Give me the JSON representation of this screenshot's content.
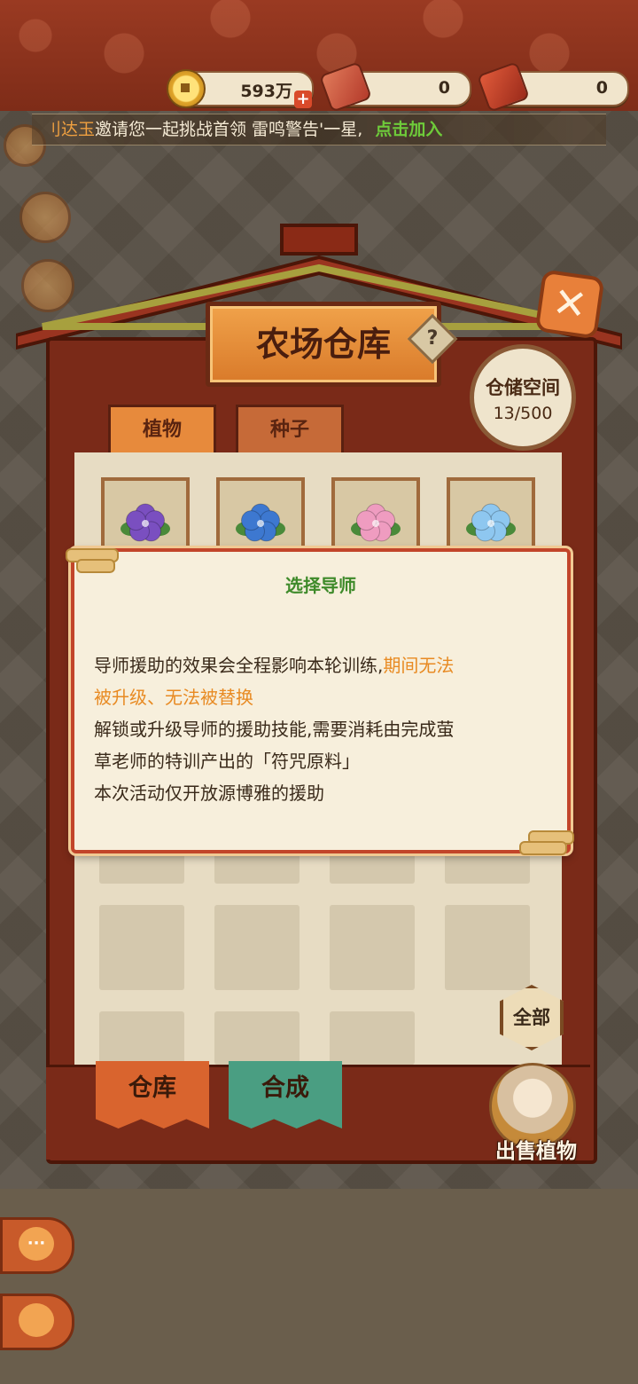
{
  "currency": {
    "coins": "593万",
    "coins_plus": "+",
    "ticket_a": "0",
    "ticket_b": "0"
  },
  "notice": {
    "name": "刂达玉",
    "message": "邀请您一起挑战首领 雷鸣警告'一星,",
    "join": "点击加入"
  },
  "warehouse": {
    "title": "农场仓库",
    "help": "?",
    "close": "✕",
    "storage_label": "仓储空间",
    "storage_value": "13/500",
    "tabs": [
      "植物",
      "种子"
    ],
    "all_button": "全部",
    "bottom_tabs": [
      "仓库",
      "合成"
    ],
    "sell_label": "出售植物",
    "flower_colors": [
      "#7a4fc0",
      "#3d78d0",
      "#ef9cc0",
      "#8ec7f0"
    ]
  },
  "dialog": {
    "title": "选择导师",
    "line1_normal": "导师援助的效果会全程影响本轮训练,",
    "line1_highlight": "期间无法",
    "line2_highlight": "被升级、无法被替换",
    "line3": "解锁或升级导师的援助技能,需要消耗由完成萤",
    "line4": "草老师的特训产出的「符咒原料」",
    "line5": "本次活动仅开放源博雅的援助"
  },
  "side_buttons": {
    "chat": "···"
  }
}
